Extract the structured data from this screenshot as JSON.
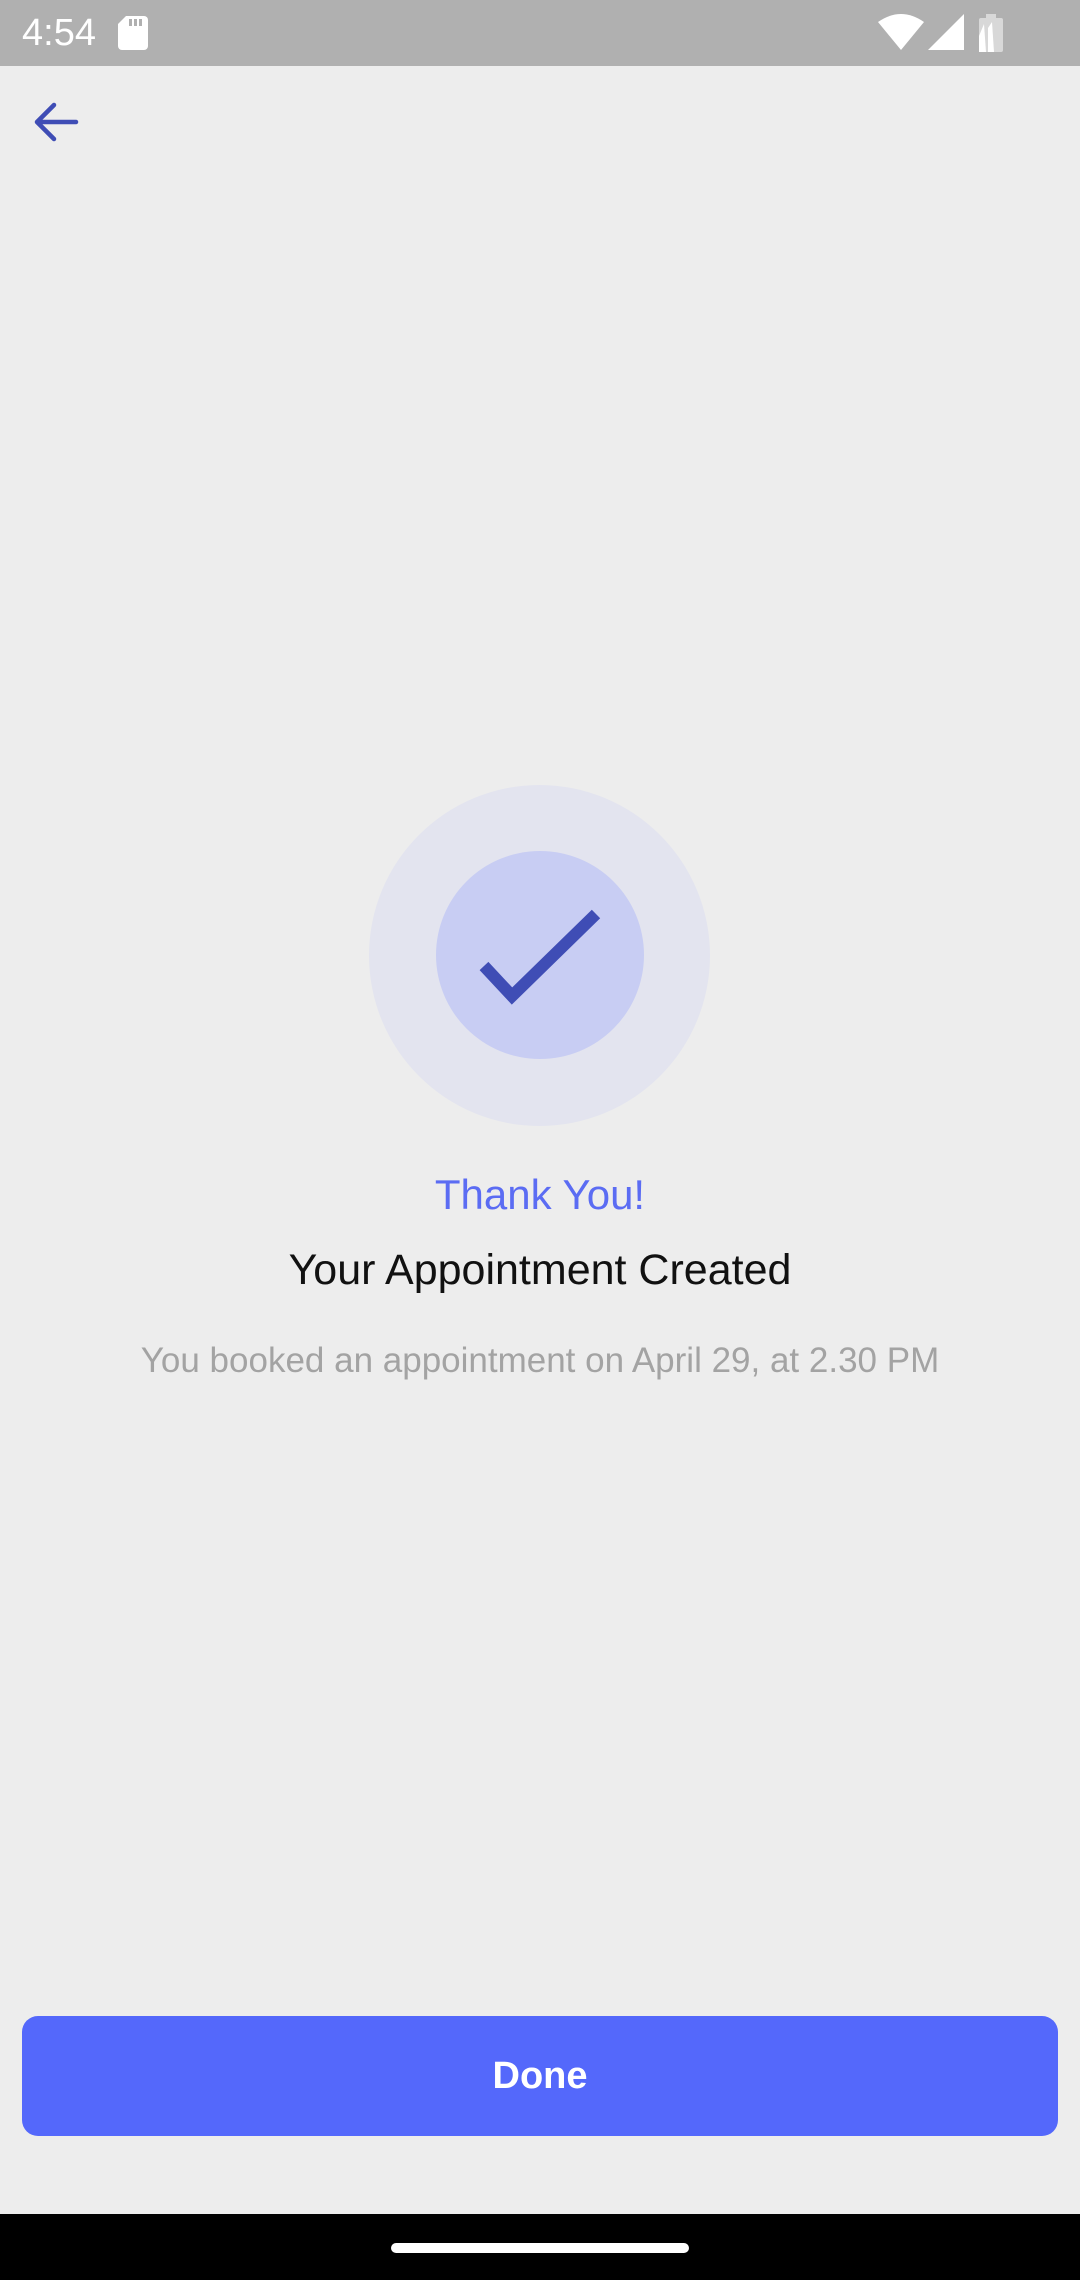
{
  "status_bar": {
    "time": "4:54",
    "icons": [
      "sd-card-icon",
      "wifi-icon",
      "signal-icon",
      "battery-icon"
    ]
  },
  "header": {
    "back_icon": "arrow-left-icon"
  },
  "success": {
    "icon": "check-icon",
    "title": "Thank You!",
    "headline": "Your Appointment Created",
    "message": "You booked an appointment on April 29, at 2.30 PM"
  },
  "actions": {
    "done_label": "Done"
  },
  "colors": {
    "accent": "#5468fb",
    "accent_text": "#5b6cf3",
    "check": "#3f4db5",
    "background": "#ededed"
  }
}
